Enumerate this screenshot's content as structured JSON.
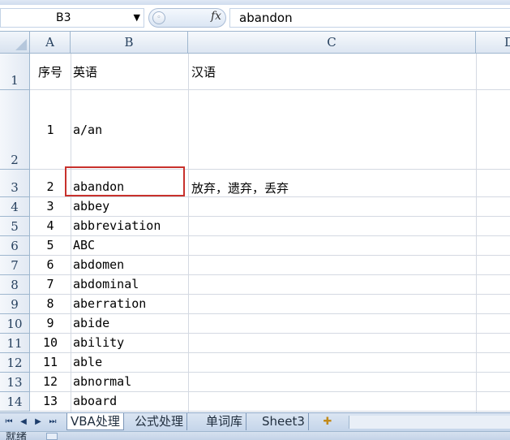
{
  "formula_bar": {
    "name_box": "B3",
    "fx_label": "fx",
    "content": "abandon"
  },
  "columns": [
    "A",
    "B",
    "C",
    "D"
  ],
  "rows": [
    {
      "num": "1",
      "a": "序号",
      "b": "英语",
      "c": "汉语"
    },
    {
      "num": "2",
      "a": "1",
      "b": "a/an",
      "c": ""
    },
    {
      "num": "3",
      "a": "2",
      "b": "abandon",
      "c": "放弃，遗弃，丢弃"
    },
    {
      "num": "4",
      "a": "3",
      "b": "abbey",
      "c": ""
    },
    {
      "num": "5",
      "a": "4",
      "b": "abbreviation",
      "c": ""
    },
    {
      "num": "6",
      "a": "5",
      "b": "ABC",
      "c": ""
    },
    {
      "num": "7",
      "a": "6",
      "b": "abdomen",
      "c": ""
    },
    {
      "num": "8",
      "a": "7",
      "b": "abdominal",
      "c": ""
    },
    {
      "num": "9",
      "a": "8",
      "b": "aberration",
      "c": ""
    },
    {
      "num": "10",
      "a": "9",
      "b": "abide",
      "c": ""
    },
    {
      "num": "11",
      "a": "10",
      "b": "ability",
      "c": ""
    },
    {
      "num": "12",
      "a": "11",
      "b": "able",
      "c": ""
    },
    {
      "num": "13",
      "a": "12",
      "b": "abnormal",
      "c": ""
    },
    {
      "num": "14",
      "a": "13",
      "b": "aboard",
      "c": ""
    }
  ],
  "sheet_tabs": [
    "VBA处理",
    "公式处理",
    "单词库",
    "Sheet3"
  ],
  "active_tab": "VBA处理",
  "status": {
    "text": "就绪"
  },
  "colors": {
    "selection_border": "#c8312c",
    "header_bg": "#dde6f2",
    "grid_line": "#d4d9e2"
  }
}
